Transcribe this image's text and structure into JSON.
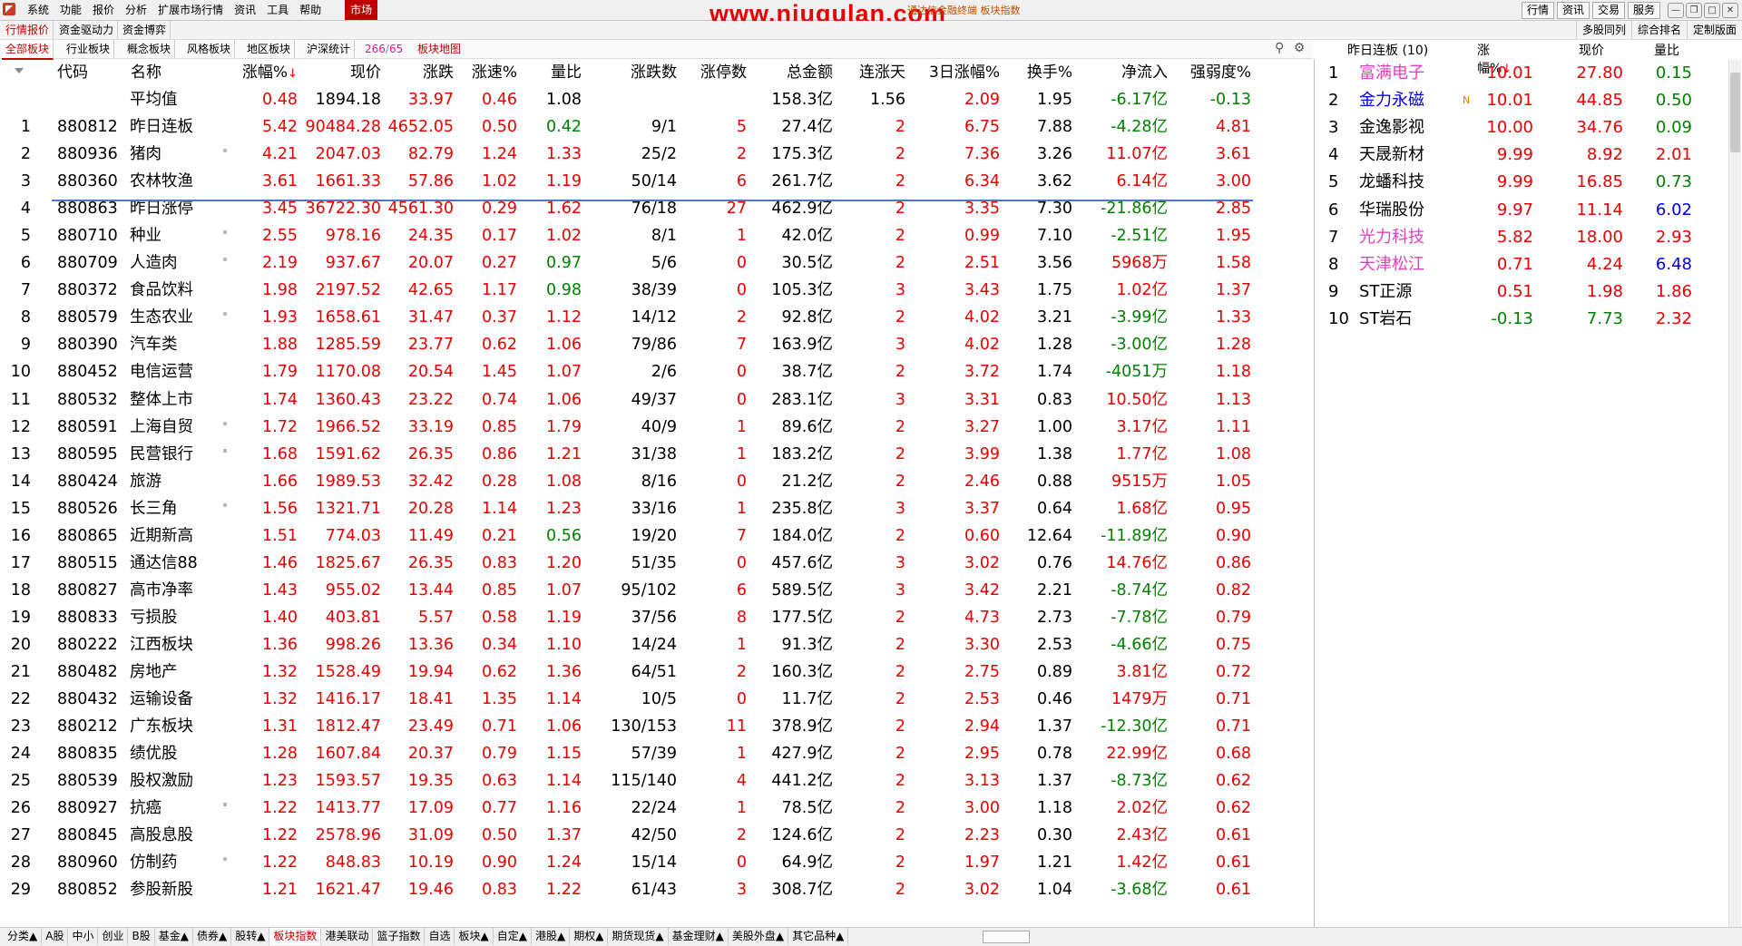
{
  "menubar": {
    "items": [
      "系统",
      "功能",
      "报价",
      "分析",
      "扩展市场行情",
      "资讯",
      "工具",
      "帮助",
      "市场"
    ],
    "active": "市场",
    "watermark": "www.niugulan.com",
    "title": "通达信金融终端 板块指数",
    "right_buttons": [
      "行情",
      "资讯",
      "交易",
      "服务"
    ],
    "window_controls": [
      "—",
      "❐",
      "□",
      "✕"
    ]
  },
  "tabbar1": {
    "tabs": [
      "行情报价",
      "资金驱动力",
      "资金博弈"
    ],
    "right_tabs": [
      "多股同列",
      "综合排名",
      "定制版面"
    ]
  },
  "tabbar2": {
    "tabs": [
      "全部板块",
      "行业板块",
      "概念板块",
      "风格板块",
      "地区板块",
      "沪深统计"
    ],
    "count_current": "266",
    "count_total": "65",
    "map_label": "板块地图"
  },
  "table": {
    "headers": {
      "code": "代码",
      "name": "名称",
      "pct": "涨幅%",
      "price": "现价",
      "chg": "涨跌",
      "speed": "涨速%",
      "vr": "量比",
      "updown": "涨跌数",
      "limitup": "涨停数",
      "amount": "总金额",
      "consec": "连涨天",
      "pct3": "3日涨幅%",
      "turnover": "换手%",
      "inflow": "净流入",
      "strength": "强弱度%"
    },
    "sort_arrow": "↓",
    "average": {
      "name": "平均值",
      "pct": "0.48",
      "price": "1894.18",
      "chg": "33.97",
      "speed": "0.46",
      "vr": "1.08",
      "amount": "158.3亿",
      "consec": "1.56",
      "pct3": "2.09",
      "turnover": "1.95",
      "inflow": "-6.17亿",
      "strength": "-0.13"
    },
    "rows": [
      {
        "n": "1",
        "code": "880812",
        "name": "昨日连板",
        "pct": "5.42",
        "price": "90484.28",
        "chg": "4652.05",
        "speed": "0.50",
        "vr": "0.42",
        "updown": "9/1",
        "limitup": "5",
        "amount": "27.4亿",
        "consec": "2",
        "pct3": "6.75",
        "turnover": "7.88",
        "inflow": "-4.28亿",
        "strength": "4.81",
        "dot": false
      },
      {
        "n": "2",
        "code": "880936",
        "name": "猪肉",
        "pct": "4.21",
        "price": "2047.03",
        "chg": "82.79",
        "speed": "1.24",
        "vr": "1.33",
        "updown": "25/2",
        "limitup": "2",
        "amount": "175.3亿",
        "consec": "2",
        "pct3": "7.36",
        "turnover": "3.26",
        "inflow": "11.07亿",
        "strength": "3.61",
        "dot": true
      },
      {
        "n": "3",
        "code": "880360",
        "name": "农林牧渔",
        "pct": "3.61",
        "price": "1661.33",
        "chg": "57.86",
        "speed": "1.02",
        "vr": "1.19",
        "updown": "50/14",
        "limitup": "6",
        "amount": "261.7亿",
        "consec": "2",
        "pct3": "6.34",
        "turnover": "3.62",
        "inflow": "6.14亿",
        "strength": "3.00",
        "dot": false
      },
      {
        "n": "4",
        "code": "880863",
        "name": "昨日涨停",
        "pct": "3.45",
        "price": "36722.30",
        "chg": "4561.30",
        "speed": "0.29",
        "vr": "1.62",
        "updown": "76/18",
        "limitup": "27",
        "amount": "462.9亿",
        "consec": "2",
        "pct3": "3.35",
        "turnover": "7.30",
        "inflow": "-21.86亿",
        "strength": "2.85",
        "dot": false
      },
      {
        "n": "5",
        "code": "880710",
        "name": "种业",
        "pct": "2.55",
        "price": "978.16",
        "chg": "24.35",
        "speed": "0.17",
        "vr": "1.02",
        "updown": "8/1",
        "limitup": "1",
        "amount": "42.0亿",
        "consec": "2",
        "pct3": "0.99",
        "turnover": "7.10",
        "inflow": "-2.51亿",
        "strength": "1.95",
        "dot": true
      },
      {
        "n": "6",
        "code": "880709",
        "name": "人造肉",
        "pct": "2.19",
        "price": "937.67",
        "chg": "20.07",
        "speed": "0.27",
        "vr": "0.97",
        "updown": "5/6",
        "limitup": "0",
        "amount": "30.5亿",
        "consec": "2",
        "pct3": "2.51",
        "turnover": "3.56",
        "inflow": "5968万",
        "strength": "1.58",
        "dot": true
      },
      {
        "n": "7",
        "code": "880372",
        "name": "食品饮料",
        "pct": "1.98",
        "price": "2197.52",
        "chg": "42.65",
        "speed": "1.17",
        "vr": "0.98",
        "updown": "38/39",
        "limitup": "0",
        "amount": "105.3亿",
        "consec": "3",
        "pct3": "3.43",
        "turnover": "1.75",
        "inflow": "1.02亿",
        "strength": "1.37",
        "dot": false
      },
      {
        "n": "8",
        "code": "880579",
        "name": "生态农业",
        "pct": "1.93",
        "price": "1658.61",
        "chg": "31.47",
        "speed": "0.37",
        "vr": "1.12",
        "updown": "14/12",
        "limitup": "2",
        "amount": "92.8亿",
        "consec": "2",
        "pct3": "4.02",
        "turnover": "3.21",
        "inflow": "-3.99亿",
        "strength": "1.33",
        "dot": true
      },
      {
        "n": "9",
        "code": "880390",
        "name": "汽车类",
        "pct": "1.88",
        "price": "1285.59",
        "chg": "23.77",
        "speed": "0.62",
        "vr": "1.06",
        "updown": "79/86",
        "limitup": "7",
        "amount": "163.9亿",
        "consec": "3",
        "pct3": "4.02",
        "turnover": "1.28",
        "inflow": "-3.00亿",
        "strength": "1.28",
        "dot": false
      },
      {
        "n": "10",
        "code": "880452",
        "name": "电信运营",
        "pct": "1.79",
        "price": "1170.08",
        "chg": "20.54",
        "speed": "1.45",
        "vr": "1.07",
        "updown": "2/6",
        "limitup": "0",
        "amount": "38.7亿",
        "consec": "2",
        "pct3": "3.72",
        "turnover": "1.74",
        "inflow": "-4051万",
        "strength": "1.18",
        "dot": false
      },
      {
        "n": "11",
        "code": "880532",
        "name": "整体上市",
        "pct": "1.74",
        "price": "1360.43",
        "chg": "23.22",
        "speed": "0.74",
        "vr": "1.06",
        "updown": "49/37",
        "limitup": "0",
        "amount": "283.1亿",
        "consec": "3",
        "pct3": "3.31",
        "turnover": "0.83",
        "inflow": "10.50亿",
        "strength": "1.13",
        "dot": false
      },
      {
        "n": "12",
        "code": "880591",
        "name": "上海自贸",
        "pct": "1.72",
        "price": "1966.52",
        "chg": "33.19",
        "speed": "0.85",
        "vr": "1.79",
        "updown": "40/9",
        "limitup": "1",
        "amount": "89.6亿",
        "consec": "2",
        "pct3": "3.27",
        "turnover": "1.00",
        "inflow": "3.17亿",
        "strength": "1.11",
        "dot": true
      },
      {
        "n": "13",
        "code": "880595",
        "name": "民营银行",
        "pct": "1.68",
        "price": "1591.62",
        "chg": "26.35",
        "speed": "0.86",
        "vr": "1.21",
        "updown": "31/38",
        "limitup": "1",
        "amount": "183.2亿",
        "consec": "2",
        "pct3": "3.99",
        "turnover": "1.38",
        "inflow": "1.77亿",
        "strength": "1.08",
        "dot": true
      },
      {
        "n": "14",
        "code": "880424",
        "name": "旅游",
        "pct": "1.66",
        "price": "1989.53",
        "chg": "32.42",
        "speed": "0.28",
        "vr": "1.08",
        "updown": "8/16",
        "limitup": "0",
        "amount": "21.2亿",
        "consec": "2",
        "pct3": "2.46",
        "turnover": "0.88",
        "inflow": "9515万",
        "strength": "1.05",
        "dot": false
      },
      {
        "n": "15",
        "code": "880526",
        "name": "长三角",
        "pct": "1.56",
        "price": "1321.71",
        "chg": "20.28",
        "speed": "1.14",
        "vr": "1.23",
        "updown": "33/16",
        "limitup": "1",
        "amount": "235.8亿",
        "consec": "3",
        "pct3": "3.37",
        "turnover": "0.64",
        "inflow": "1.68亿",
        "strength": "0.95",
        "dot": true
      },
      {
        "n": "16",
        "code": "880865",
        "name": "近期新高",
        "pct": "1.51",
        "price": "774.03",
        "chg": "11.49",
        "speed": "0.21",
        "vr": "0.56",
        "updown": "19/20",
        "limitup": "7",
        "amount": "184.0亿",
        "consec": "2",
        "pct3": "0.60",
        "turnover": "12.64",
        "inflow": "-11.89亿",
        "strength": "0.90",
        "dot": false
      },
      {
        "n": "17",
        "code": "880515",
        "name": "通达信88",
        "pct": "1.46",
        "price": "1825.67",
        "chg": "26.35",
        "speed": "0.83",
        "vr": "1.20",
        "updown": "51/35",
        "limitup": "0",
        "amount": "457.6亿",
        "consec": "3",
        "pct3": "3.02",
        "turnover": "0.76",
        "inflow": "14.76亿",
        "strength": "0.86",
        "dot": false
      },
      {
        "n": "18",
        "code": "880827",
        "name": "高市净率",
        "pct": "1.43",
        "price": "955.02",
        "chg": "13.44",
        "speed": "0.85",
        "vr": "1.07",
        "updown": "95/102",
        "limitup": "6",
        "amount": "589.5亿",
        "consec": "3",
        "pct3": "3.42",
        "turnover": "2.21",
        "inflow": "-8.74亿",
        "strength": "0.82",
        "dot": false
      },
      {
        "n": "19",
        "code": "880833",
        "name": "亏损股",
        "pct": "1.40",
        "price": "403.81",
        "chg": "5.57",
        "speed": "0.58",
        "vr": "1.19",
        "updown": "37/56",
        "limitup": "8",
        "amount": "177.5亿",
        "consec": "2",
        "pct3": "4.73",
        "turnover": "2.73",
        "inflow": "-7.78亿",
        "strength": "0.79",
        "dot": false
      },
      {
        "n": "20",
        "code": "880222",
        "name": "江西板块",
        "pct": "1.36",
        "price": "998.26",
        "chg": "13.36",
        "speed": "0.34",
        "vr": "1.10",
        "updown": "14/24",
        "limitup": "1",
        "amount": "91.3亿",
        "consec": "2",
        "pct3": "3.30",
        "turnover": "2.53",
        "inflow": "-4.66亿",
        "strength": "0.75",
        "dot": false
      },
      {
        "n": "21",
        "code": "880482",
        "name": "房地产",
        "pct": "1.32",
        "price": "1528.49",
        "chg": "19.94",
        "speed": "0.62",
        "vr": "1.36",
        "updown": "64/51",
        "limitup": "2",
        "amount": "160.3亿",
        "consec": "2",
        "pct3": "2.75",
        "turnover": "0.89",
        "inflow": "3.81亿",
        "strength": "0.72",
        "dot": false
      },
      {
        "n": "22",
        "code": "880432",
        "name": "运输设备",
        "pct": "1.32",
        "price": "1416.17",
        "chg": "18.41",
        "speed": "1.35",
        "vr": "1.14",
        "updown": "10/5",
        "limitup": "0",
        "amount": "11.7亿",
        "consec": "2",
        "pct3": "2.53",
        "turnover": "0.46",
        "inflow": "1479万",
        "strength": "0.71",
        "dot": false
      },
      {
        "n": "23",
        "code": "880212",
        "name": "广东板块",
        "pct": "1.31",
        "price": "1812.47",
        "chg": "23.49",
        "speed": "0.71",
        "vr": "1.06",
        "updown": "130/153",
        "limitup": "11",
        "amount": "378.9亿",
        "consec": "2",
        "pct3": "2.94",
        "turnover": "1.37",
        "inflow": "-12.30亿",
        "strength": "0.71",
        "dot": false
      },
      {
        "n": "24",
        "code": "880835",
        "name": "绩优股",
        "pct": "1.28",
        "price": "1607.84",
        "chg": "20.37",
        "speed": "0.79",
        "vr": "1.15",
        "updown": "57/39",
        "limitup": "1",
        "amount": "427.9亿",
        "consec": "2",
        "pct3": "2.95",
        "turnover": "0.78",
        "inflow": "22.99亿",
        "strength": "0.68",
        "dot": false
      },
      {
        "n": "25",
        "code": "880539",
        "name": "股权激励",
        "pct": "1.23",
        "price": "1593.57",
        "chg": "19.35",
        "speed": "0.63",
        "vr": "1.14",
        "updown": "115/140",
        "limitup": "4",
        "amount": "441.2亿",
        "consec": "2",
        "pct3": "3.13",
        "turnover": "1.37",
        "inflow": "-8.73亿",
        "strength": "0.62",
        "dot": false
      },
      {
        "n": "26",
        "code": "880927",
        "name": "抗癌",
        "pct": "1.22",
        "price": "1413.77",
        "chg": "17.09",
        "speed": "0.77",
        "vr": "1.16",
        "updown": "22/24",
        "limitup": "1",
        "amount": "78.5亿",
        "consec": "2",
        "pct3": "3.00",
        "turnover": "1.18",
        "inflow": "2.02亿",
        "strength": "0.62",
        "dot": true
      },
      {
        "n": "27",
        "code": "880845",
        "name": "高股息股",
        "pct": "1.22",
        "price": "2578.96",
        "chg": "31.09",
        "speed": "0.50",
        "vr": "1.37",
        "updown": "42/50",
        "limitup": "2",
        "amount": "124.6亿",
        "consec": "2",
        "pct3": "2.23",
        "turnover": "0.30",
        "inflow": "2.43亿",
        "strength": "0.61",
        "dot": false
      },
      {
        "n": "28",
        "code": "880960",
        "name": "仿制药",
        "pct": "1.22",
        "price": "848.83",
        "chg": "10.19",
        "speed": "0.90",
        "vr": "1.24",
        "updown": "15/14",
        "limitup": "0",
        "amount": "64.9亿",
        "consec": "2",
        "pct3": "1.97",
        "turnover": "1.21",
        "inflow": "1.42亿",
        "strength": "0.61",
        "dot": true
      },
      {
        "n": "29",
        "code": "880852",
        "name": "参股新股",
        "pct": "1.21",
        "price": "1621.47",
        "chg": "19.46",
        "speed": "0.83",
        "vr": "1.22",
        "updown": "61/43",
        "limitup": "3",
        "amount": "308.7亿",
        "consec": "2",
        "pct3": "3.02",
        "turnover": "1.04",
        "inflow": "-3.68亿",
        "strength": "0.61",
        "dot": false
      }
    ]
  },
  "panel": {
    "title": "昨日连板 (10)",
    "headers": {
      "pct": "涨幅%",
      "price": "现价",
      "vr": "量比"
    },
    "sort_arrow": "↓",
    "rows": [
      {
        "n": "1",
        "name": "富满电子",
        "pct": "10.01",
        "price": "27.80",
        "vr": "0.15",
        "name_color": "pink",
        "vr_color": "green",
        "flag": ""
      },
      {
        "n": "2",
        "name": "金力永磁",
        "pct": "10.01",
        "price": "44.85",
        "vr": "0.50",
        "name_color": "blue",
        "vr_color": "green",
        "flag": "N"
      },
      {
        "n": "3",
        "name": "金逸影视",
        "pct": "10.00",
        "price": "34.76",
        "vr": "0.09",
        "name_color": "black",
        "vr_color": "green",
        "flag": ""
      },
      {
        "n": "4",
        "name": "天晟新材",
        "pct": "9.99",
        "price": "8.92",
        "vr": "2.01",
        "name_color": "black",
        "vr_color": "red",
        "flag": ""
      },
      {
        "n": "5",
        "name": "龙蟠科技",
        "pct": "9.99",
        "price": "16.85",
        "vr": "0.73",
        "name_color": "black",
        "vr_color": "green",
        "flag": ""
      },
      {
        "n": "6",
        "name": "华瑞股份",
        "pct": "9.97",
        "price": "11.14",
        "vr": "6.02",
        "name_color": "black",
        "vr_color": "blue",
        "flag": ""
      },
      {
        "n": "7",
        "name": "光力科技",
        "pct": "5.82",
        "price": "18.00",
        "vr": "2.93",
        "name_color": "pink",
        "vr_color": "red",
        "flag": ""
      },
      {
        "n": "8",
        "name": "天津松江",
        "pct": "0.71",
        "price": "4.24",
        "vr": "6.48",
        "name_color": "pink",
        "vr_color": "blue",
        "flag": ""
      },
      {
        "n": "9",
        "name": "ST正源",
        "pct": "0.51",
        "price": "1.98",
        "vr": "1.86",
        "name_color": "black",
        "vr_color": "red",
        "flag": ""
      },
      {
        "n": "10",
        "name": "ST岩石",
        "pct": "-0.13",
        "price": "7.73",
        "vr": "2.32",
        "name_color": "black",
        "vr_color": "red",
        "flag": ""
      }
    ]
  },
  "bottom_tabs": [
    "分类▲",
    "A股",
    "中小",
    "创业",
    "B股",
    "基金▲",
    "债券▲",
    "股转▲",
    "板块指数",
    "港美联动",
    "篮子指数",
    "自选",
    "板块▲",
    "自定▲",
    "港股▲",
    "期权▲",
    "期货现货▲",
    "基金理财▲",
    "美股外盘▲",
    "其它品种▲"
  ],
  "bottom_active": "板块指数",
  "colors": {
    "up": "#e60000",
    "down": "#008000",
    "accent": "#c00000",
    "selection": "#5078c8"
  }
}
